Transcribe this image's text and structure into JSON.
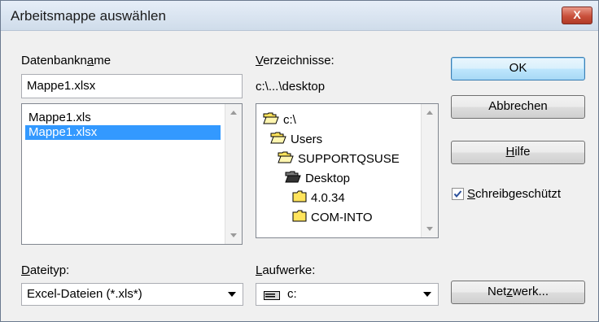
{
  "window": {
    "title": "Arbeitsmappe auswählen",
    "close_glyph": "X"
  },
  "left": {
    "db_label": {
      "prefix": "Datenbankn",
      "mnemonic": "a",
      "suffix": "me"
    },
    "db_value": "Mappe1.xlsx",
    "files": [
      "Mappe1.xls",
      "Mappe1.xlsx"
    ],
    "selected_index": 1,
    "type_label": {
      "mnemonic": "D",
      "suffix": "ateityp:"
    },
    "type_value": "Excel-Dateien (*.xls*)"
  },
  "middle": {
    "dir_label": {
      "mnemonic": "V",
      "suffix": "erzeichnisse:"
    },
    "current_path": "c:\\...\\desktop",
    "dirs": [
      {
        "name": "c:\\",
        "icon": "open-folder-icon"
      },
      {
        "name": "Users",
        "icon": "open-folder-icon"
      },
      {
        "name": "SUPPORTQSUSE",
        "icon": "open-folder-icon"
      },
      {
        "name": "Desktop",
        "icon": "open-folder-dark-icon"
      },
      {
        "name": "4.0.34",
        "icon": "folder-icon"
      },
      {
        "name": "COM-INTO",
        "icon": "folder-icon"
      }
    ],
    "drive_label": {
      "mnemonic": "L",
      "suffix": "aufwerke:"
    },
    "drive_value": "c:",
    "drive_icon": "drive-icon"
  },
  "right": {
    "ok": "OK",
    "cancel": "Abbrechen",
    "help": {
      "mnemonic": "H",
      "suffix": "ilfe"
    },
    "readonly": {
      "mnemonic": "S",
      "suffix": "chreibgeschützt",
      "checked": true
    },
    "network": {
      "prefix": "Net",
      "mnemonic": "z",
      "suffix": "werk..."
    }
  }
}
